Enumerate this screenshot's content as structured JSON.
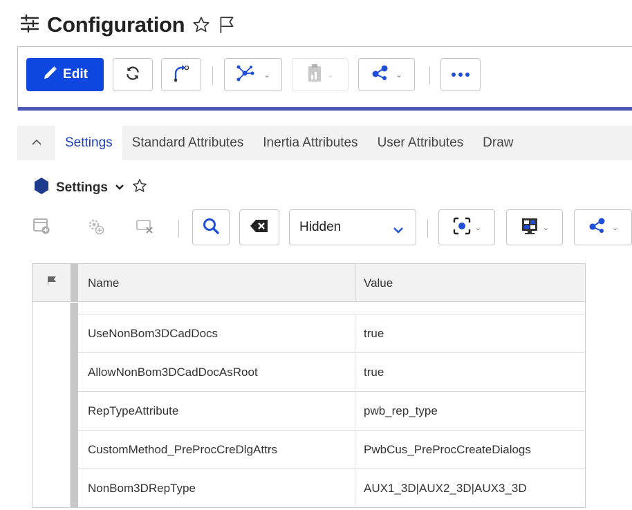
{
  "page": {
    "title": "Configuration",
    "icons": {
      "title": "sliders-icon",
      "favorite": "star-outline-icon",
      "follow": "flag-outline-icon"
    }
  },
  "toolbar": {
    "edit_label": "Edit",
    "icons": [
      "pencil-icon",
      "refresh-icon",
      "revise-icon",
      "structure-icon",
      "clipboard-icon",
      "share-icon",
      "more-icon"
    ]
  },
  "tabs": {
    "items": [
      {
        "label": "Settings",
        "active": true
      },
      {
        "label": "Standard Attributes",
        "active": false
      },
      {
        "label": "Inertia Attributes",
        "active": false
      },
      {
        "label": "User Attributes",
        "active": false
      },
      {
        "label": "Draw",
        "active": false
      }
    ]
  },
  "section": {
    "title": "Settings",
    "icons": [
      "hexagon-icon",
      "chevron-down-icon",
      "star-outline-icon"
    ]
  },
  "subtoolbar": {
    "filter_selected": "Hidden",
    "icons": [
      "new-table-icon",
      "add-setting-icon",
      "remove-icon",
      "search-icon",
      "clear-icon",
      "view-icon",
      "layout-icon",
      "share-icon"
    ]
  },
  "table": {
    "columns": [
      "Name",
      "Value"
    ],
    "rows": [
      {
        "name": "UseNonBom3DCadDocs",
        "value": "true"
      },
      {
        "name": "AllowNonBom3DCadDocAsRoot",
        "value": "true"
      },
      {
        "name": "RepTypeAttribute",
        "value": "pwb_rep_type"
      },
      {
        "name": "CustomMethod_PreProcCreDlgAttrs",
        "value": "PwbCus_PreProcCreateDialogs"
      },
      {
        "name": "NonBom3DRepType",
        "value": "AUX1_3D|AUX2_3D|AUX3_3D"
      }
    ]
  },
  "colors": {
    "primary": "#0d47e0",
    "accent_bar": "#4a55b8",
    "active_tab": "#1f3fb0",
    "hexagon": "#1e3a8a"
  }
}
